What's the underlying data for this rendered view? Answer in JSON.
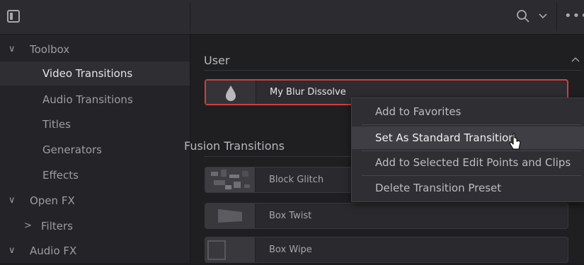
{
  "topbar": {
    "panel_toggle_icon": "panel-toggle-icon",
    "search_icon": "search-icon",
    "dropdown_icon": "chevron-down-icon",
    "more_icon": "more-icon",
    "more_glyph": "•••"
  },
  "sidebar": {
    "items": [
      {
        "label": "Toolbox",
        "chevron": "∨",
        "indent": "group"
      },
      {
        "label": "Video Transitions",
        "chevron": "",
        "indent": "child",
        "selected": true
      },
      {
        "label": "Audio Transitions",
        "chevron": "",
        "indent": "child"
      },
      {
        "label": "Titles",
        "chevron": "",
        "indent": "child"
      },
      {
        "label": "Generators",
        "chevron": "",
        "indent": "child"
      },
      {
        "label": "Effects",
        "chevron": "",
        "indent": "child"
      },
      {
        "label": "Open FX",
        "chevron": "∨",
        "indent": "group"
      },
      {
        "label": "Filters",
        "chevron": ">",
        "indent": "subgroup"
      },
      {
        "label": "Audio FX",
        "chevron": "∨",
        "indent": "group"
      }
    ]
  },
  "main": {
    "user_section": {
      "title": "User",
      "collapse_icon": "chevron-up-icon"
    },
    "user_items": [
      {
        "name": "My Blur Dissolve",
        "thumb_icon": "droplet-icon",
        "highlighted": true
      }
    ],
    "fusion_section": {
      "title": "Fusion Transitions"
    },
    "fusion_items": [
      {
        "name": "Block Glitch",
        "thumb_icon": "glitch-thumbnail"
      },
      {
        "name": "Box Twist",
        "thumb_icon": "box-twist-thumbnail"
      },
      {
        "name": "Box Wipe",
        "thumb_icon": "box-wipe-thumbnail"
      }
    ]
  },
  "context_menu": {
    "items": [
      {
        "label": "Add to Favorites"
      },
      {
        "label": "Set As Standard Transition",
        "active": true
      },
      {
        "label": "Add to Selected Edit Points and Clips"
      },
      {
        "label": "Delete Transition Preset"
      }
    ]
  },
  "colors": {
    "highlight_border": "#d2403a",
    "menu_bg": "#2e2e33",
    "menu_active_bg": "#3e3e44"
  }
}
